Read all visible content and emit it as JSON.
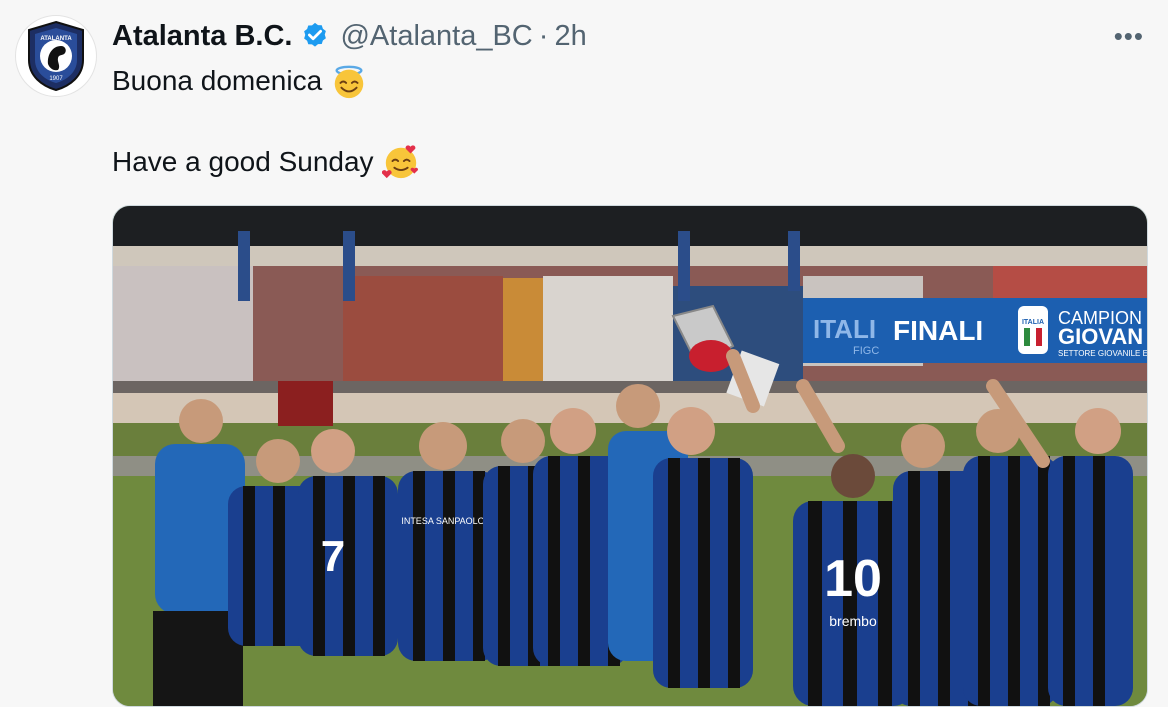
{
  "tweet": {
    "display_name": "Atalanta B.C.",
    "handle": "@Atalanta_BC",
    "separator": "·",
    "time": "2h",
    "more_label": "•••",
    "line1": "Buona domenica",
    "line2": "Have a good Sunday",
    "line1_emoji": "smiling-face-with-halo-icon",
    "line2_emoji": "smiling-face-with-hearts-icon"
  },
  "avatar": {
    "logo_text": "ATALANTA",
    "logo_year": "1907"
  },
  "photo": {
    "banner_label": "FINALI",
    "banner_right_top": "CAMPION",
    "banner_right_mid": "GIOVAN",
    "banner_right_small": "SETTORE GIOVANILE E S",
    "banner_left": "ITALI",
    "badge_text": "ITALIA",
    "jersey_number": "10",
    "jersey_number_left": "7",
    "sponsor": "brembo",
    "chest_sponsor": "INTESA SANPAOLO",
    "figc_label": "FIGC"
  },
  "colors": {
    "name": "#0f1419",
    "muted": "#536471",
    "verified": "#1d9bf0",
    "banner_blue": "#1c5fb0",
    "kit_blue": "#1a3f8f",
    "kit_black": "#111111"
  }
}
